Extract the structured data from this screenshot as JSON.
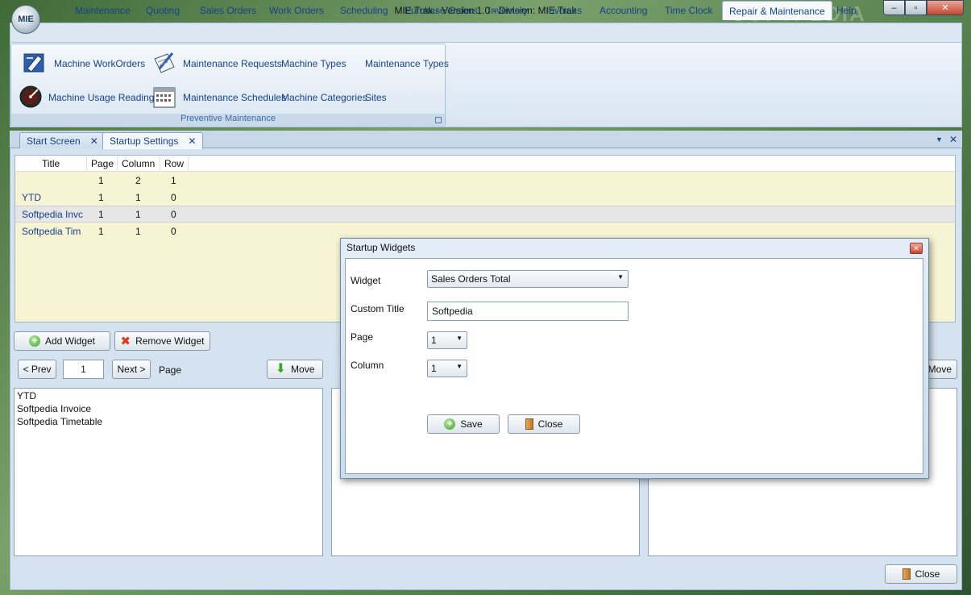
{
  "window": {
    "title": "MIE Trak - Version 1.0 - Division:  MIE Trak",
    "logo_text": "MIE",
    "watermark": "SOFTPEDIA",
    "minimize": "–",
    "maximize": "▫",
    "close": "✕"
  },
  "ribbon": {
    "tabs": [
      "Maintenance",
      "Quoting",
      "Sales Orders",
      "Work Orders",
      "Scheduling",
      "Purchase Orders",
      "Inventory",
      "Invoices",
      "Accounting",
      "Time Clock",
      "Repair & Maintenance",
      "Help"
    ],
    "active_tab": "Repair & Maintenance",
    "group_label": "Preventive Maintenance",
    "items": {
      "machine_workorders": "Machine WorkOrders",
      "maintenance_requests": "Maintenance Requests",
      "machine_types": "Machine Types",
      "maintenance_types": "Maintenance Types",
      "machine_usage_reading": "Machine Usage Reading",
      "maintenance_schedules": "Maintenance Schedules",
      "machine_categories": "Machine Categories",
      "sites": "Sites"
    }
  },
  "doc_tabs": {
    "start_screen": "Start Screen",
    "startup_settings": "Startup Settings",
    "close_glyph": "✕",
    "dropdown_glyph": "▼"
  },
  "grid": {
    "columns": [
      "Title",
      "Page",
      "Column",
      "Row"
    ],
    "rows": [
      {
        "title": "",
        "page": "1",
        "column": "2",
        "row": "1"
      },
      {
        "title": "YTD",
        "page": "1",
        "column": "1",
        "row": "0"
      },
      {
        "title": "Softpedia Invc",
        "page": "1",
        "column": "1",
        "row": "0"
      },
      {
        "title": "Softpedia Tim",
        "page": "1",
        "column": "1",
        "row": "0"
      }
    ]
  },
  "controls": {
    "add_widget": "Add Widget",
    "remove_widget": "Remove Widget",
    "prev": "< Prev",
    "page_value": "1",
    "next": "Next >",
    "page_label": "Page",
    "move": "Move",
    "move_right": "Move",
    "close": "Close"
  },
  "list_left": [
    "YTD",
    "Softpedia Invoice",
    "Softpedia Timetable"
  ],
  "dialog": {
    "title": "Startup Widgets",
    "widget_label": "Widget",
    "widget_value": "Sales Orders Total",
    "custom_title_label": "Custom Title",
    "custom_title_value": "Softpedia",
    "page_label": "Page",
    "page_value": "1",
    "column_label": "Column",
    "column_value": "1",
    "save": "Save",
    "close": "Close"
  }
}
